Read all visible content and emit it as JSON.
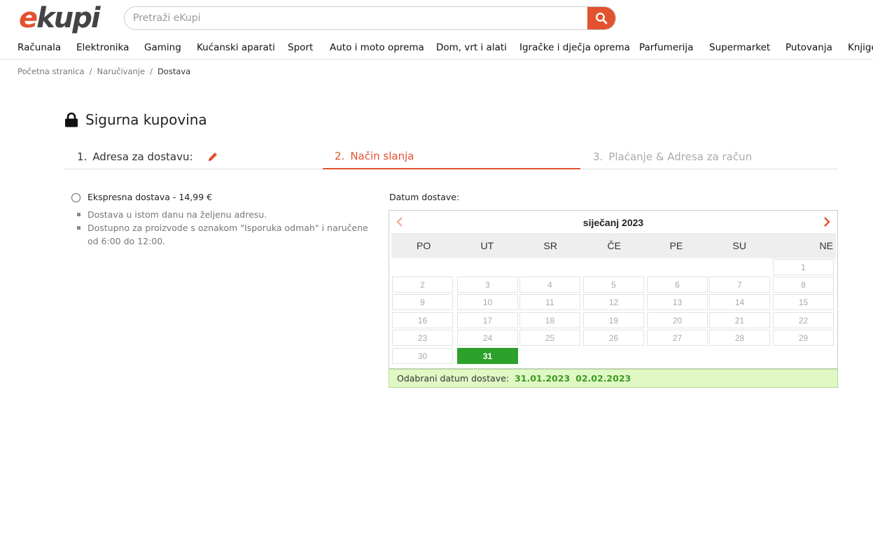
{
  "logo": {
    "first": "e",
    "rest": "kupi"
  },
  "search": {
    "placeholder": "Pretraži eKupi"
  },
  "nav": [
    "Računala",
    "Elektronika",
    "Gaming",
    "Kućanski aparati",
    "Sport",
    "Auto i moto oprema",
    "Dom, vrt i alati",
    "Igračke i dječja oprema",
    "Parfumerija",
    "Supermarket",
    "Putovanja",
    "Knjige"
  ],
  "breadcrumb": {
    "home": "Početna stranica",
    "order": "Naručivanje",
    "current": "Dostava",
    "separator": "/"
  },
  "secure_title": "Sigurna kupovina",
  "steps": [
    {
      "num": "1.",
      "label": "Adresa za dostavu:"
    },
    {
      "num": "2.",
      "label": "Način slanja"
    },
    {
      "num": "3.",
      "label": "Plaćanje & Adresa za račun"
    }
  ],
  "delivery_option": {
    "title": "Ekspresna dostava - 14,99 €",
    "bullets": [
      "Dostava u istom danu na željenu adresu.",
      "Dostupno za proizvode s oznakom \"Isporuka odmah\" i naručene od 6:00 do 12:00."
    ]
  },
  "calendar": {
    "label": "Datum dostave:",
    "month": "siječanj 2023",
    "weekdays": [
      "PO",
      "UT",
      "SR",
      "ČE",
      "PE",
      "SU",
      "NE"
    ],
    "days": [
      "1",
      "2",
      "3",
      "4",
      "5",
      "6",
      "7",
      "8",
      "9",
      "10",
      "11",
      "12",
      "13",
      "14",
      "15",
      "16",
      "17",
      "18",
      "19",
      "20",
      "21",
      "22",
      "23",
      "24",
      "25",
      "26",
      "27",
      "28",
      "29",
      "30",
      "31"
    ],
    "first_day_column": 6,
    "selected_day": "31"
  },
  "selected_bar": {
    "label": "Odabrani datum dostave:",
    "date1": "31.01.2023",
    "date2": "02.02.2023"
  },
  "colors": {
    "brand": "#e2522f",
    "selected": "#2da12a",
    "bar_bg": "#e0f8c4"
  }
}
